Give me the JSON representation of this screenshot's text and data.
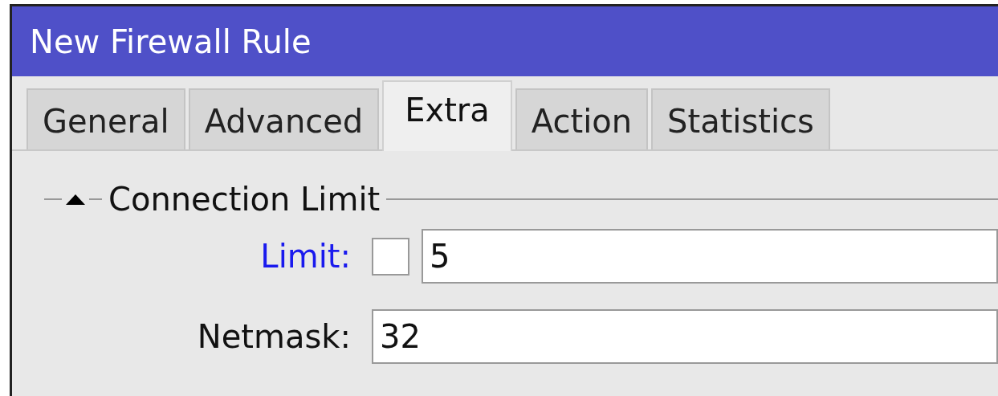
{
  "window": {
    "title": "New Firewall Rule"
  },
  "tabs": [
    {
      "label": "General",
      "selected": false
    },
    {
      "label": "Advanced",
      "selected": false
    },
    {
      "label": "Extra",
      "selected": true
    },
    {
      "label": "Action",
      "selected": false
    },
    {
      "label": "Statistics",
      "selected": false
    }
  ],
  "section": {
    "title": "Connection Limit",
    "expanded": true
  },
  "fields": [
    {
      "kind": "negatable",
      "label": "Limit:",
      "highlighted": true,
      "checked": false,
      "value": "5"
    },
    {
      "kind": "plain",
      "label": "Netmask:",
      "highlighted": false,
      "value": "32"
    }
  ]
}
